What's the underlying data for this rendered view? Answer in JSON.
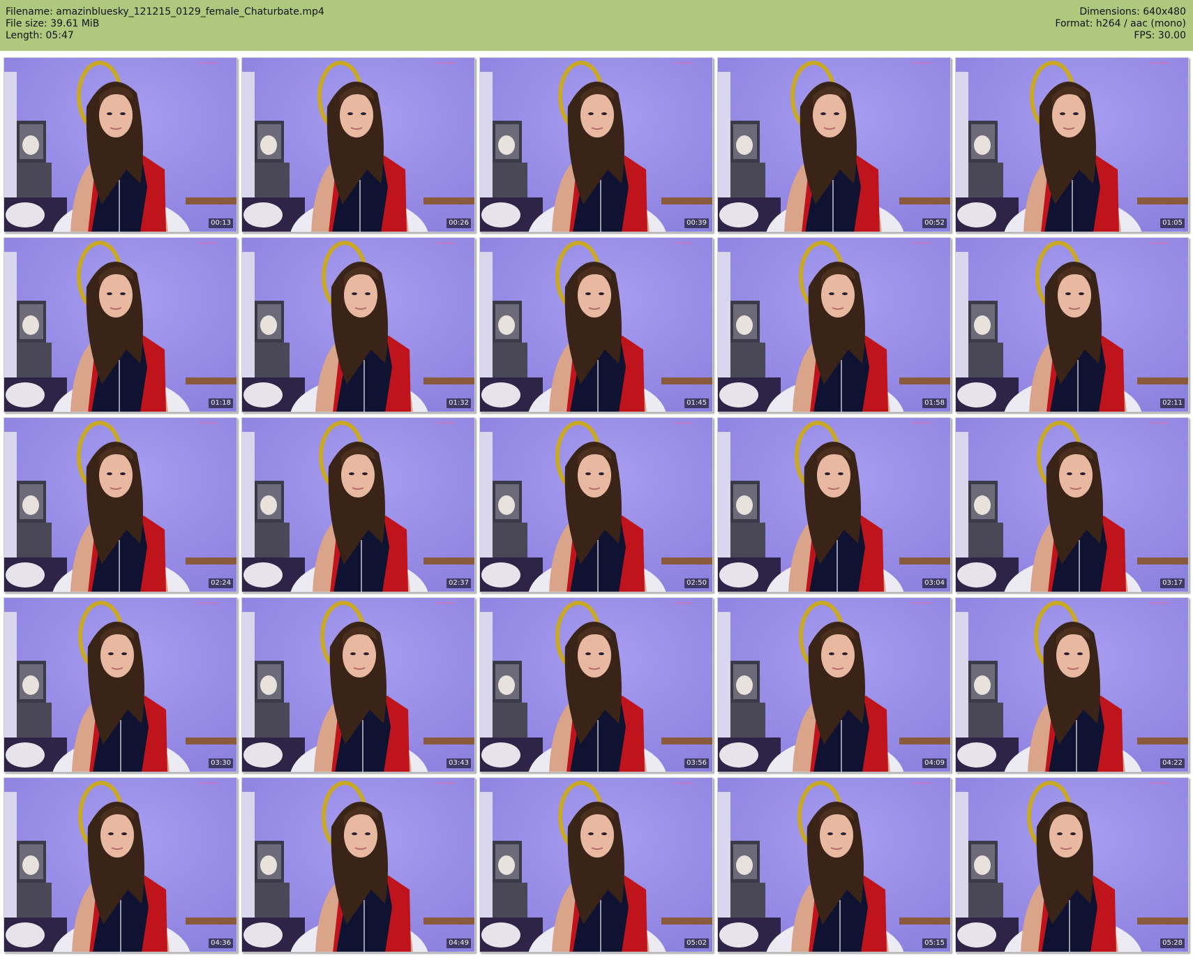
{
  "header": {
    "filename": "Filename: amazinbluesky_121215_0129_female_Chaturbate.mp4",
    "filesize": "File size: 39.61 MiB",
    "length": "Length: 05:47",
    "dimensions": "Dimensions: 640x480",
    "format": "Format: h264 / aac (mono)",
    "fps": "FPS: 30.00"
  },
  "colors": {
    "header_background": "#aec97d",
    "wall": "#8c80de",
    "top_color": "#c0141c",
    "vest_color": "#0f1230"
  },
  "thumbnails": [
    {
      "time": "00:13"
    },
    {
      "time": "00:26"
    },
    {
      "time": "00:39"
    },
    {
      "time": "00:52"
    },
    {
      "time": "01:05"
    },
    {
      "time": "01:18"
    },
    {
      "time": "01:32"
    },
    {
      "time": "01:45"
    },
    {
      "time": "01:58"
    },
    {
      "time": "02:11"
    },
    {
      "time": "02:24"
    },
    {
      "time": "02:37"
    },
    {
      "time": "02:50"
    },
    {
      "time": "03:04"
    },
    {
      "time": "03:17"
    },
    {
      "time": "03:30"
    },
    {
      "time": "03:43"
    },
    {
      "time": "03:56"
    },
    {
      "time": "04:09"
    },
    {
      "time": "04:22"
    },
    {
      "time": "04:36"
    },
    {
      "time": "04:49"
    },
    {
      "time": "05:02"
    },
    {
      "time": "05:15"
    },
    {
      "time": "05:28"
    }
  ]
}
